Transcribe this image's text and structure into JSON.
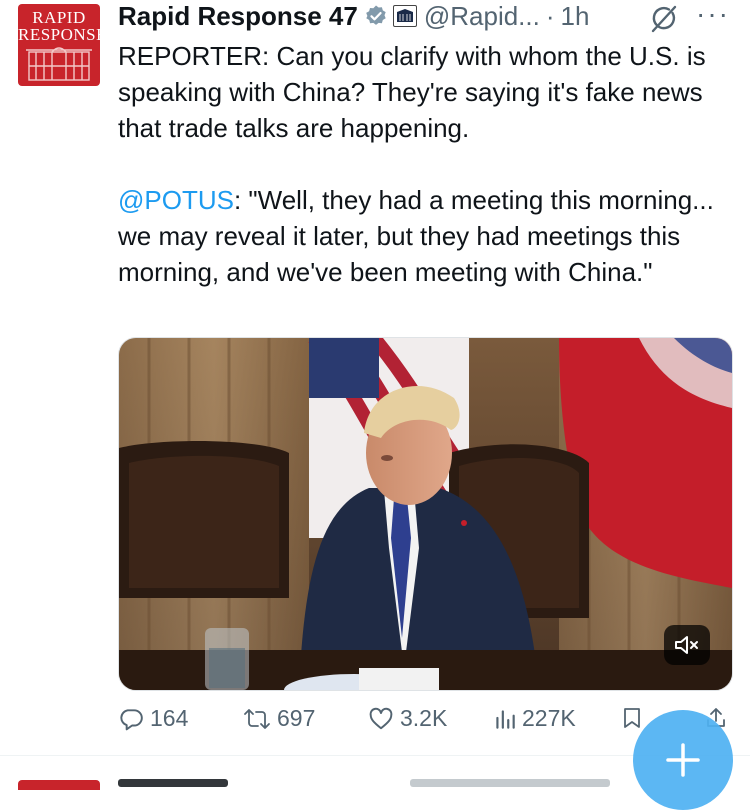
{
  "post": {
    "avatar": {
      "line1": "RAPID",
      "line2": "RESPONSE"
    },
    "author_name": "Rapid Response 47",
    "handle": "@Rapid...",
    "separator": "·",
    "time": "1h",
    "more_label": "···",
    "text": {
      "paragraph1": "REPORTER: Can you clarify with whom the U.S. is speaking with China? They're saying it's fake news that trade talks are happening.",
      "mention": "@POTUS",
      "paragraph2_rest": ": \"Well, they had a meeting this morning... we may reveal it later, but they had meetings this morning, and we've been meeting with China.\""
    },
    "media": {
      "type": "video",
      "muted": true
    }
  },
  "actions": {
    "replies": "164",
    "reposts": "697",
    "likes": "3.2K",
    "views": "227K"
  },
  "colors": {
    "accent": "#1d9bf0",
    "secondary_text": "#536471",
    "avatar_bg": "#c8242b",
    "fab_bg": "#4fb1f2"
  },
  "icons": [
    "verified-badge-icon",
    "affiliate-whitehouse-icon",
    "grok-icon",
    "more-icon",
    "mute-icon",
    "reply-icon",
    "repost-icon",
    "like-icon",
    "views-icon",
    "bookmark-icon",
    "share-icon",
    "compose-plus-icon"
  ]
}
